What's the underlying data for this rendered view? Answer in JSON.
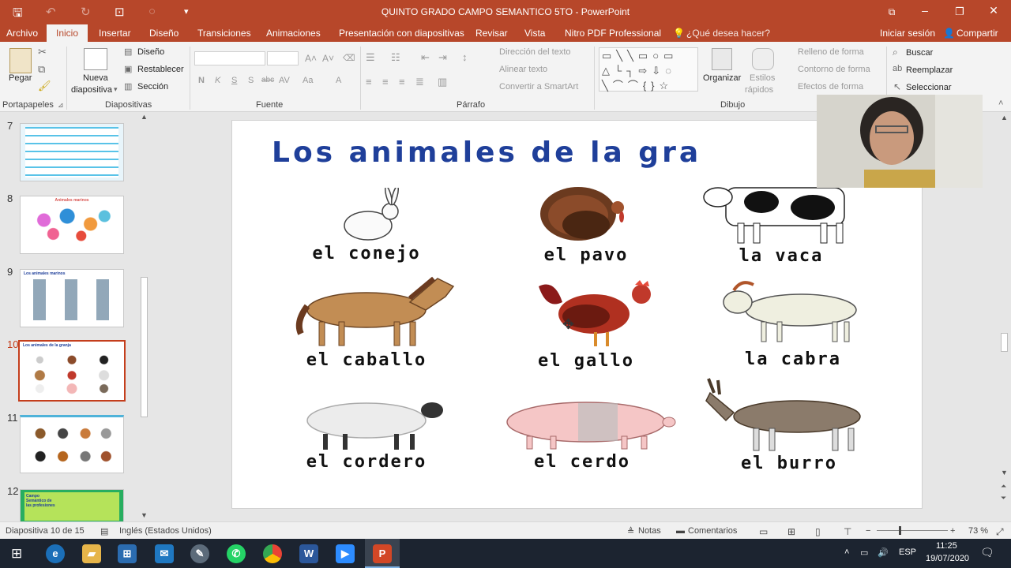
{
  "app": {
    "title": "QUINTO GRADO CAMPO SEMANTICO 5TO - PowerPoint"
  },
  "tabs": [
    "Archivo",
    "Inicio",
    "Insertar",
    "Diseño",
    "Transiciones",
    "Animaciones",
    "Presentación con diapositivas",
    "Revisar",
    "Vista",
    "Nitro PDF Professional"
  ],
  "tellme": "¿Qué desea hacer?",
  "signin": "Iniciar sesión",
  "share": "Compartir",
  "ribbon": {
    "pegar": "Pegar",
    "nueva": "Nueva",
    "diapositiva": "diapositiva",
    "diseno": "Diseño",
    "restablecer": "Restablecer",
    "seccion": "Sección",
    "font_btns": [
      "N",
      "K",
      "S",
      "S",
      "abc",
      "AV",
      "Aa",
      "A"
    ],
    "direccion": "Dirección del texto",
    "alinear": "Alinear texto",
    "convertir": "Convertir a SmartArt",
    "organizar": "Organizar",
    "estilos": "Estilos",
    "rapidos": "rápidos",
    "relleno": "Relleno de forma",
    "contorno": "Contorno de forma",
    "efectos": "Efectos de forma",
    "buscar": "Buscar",
    "reemplazar": "Reemplazar",
    "seleccionar": "Seleccionar",
    "groups": [
      "Portapapeles",
      "Diapositivas",
      "Fuente",
      "Párrafo",
      "Dibujo"
    ]
  },
  "slides": [
    {
      "num": "7",
      "caption": ""
    },
    {
      "num": "8",
      "caption": "Animales marinos"
    },
    {
      "num": "9",
      "caption": "Los animales marinos"
    },
    {
      "num": "10",
      "caption": "Los animales de la granja"
    },
    {
      "num": "11",
      "caption": ""
    },
    {
      "num": "12",
      "caption": "Campo Semántico de las profesiones"
    }
  ],
  "slide": {
    "title": "Los animales de la gra",
    "animals": [
      "el conejo",
      "el pavo",
      "la vaca",
      "el caballo",
      "el gallo",
      "la cabra",
      "el cordero",
      "el cerdo",
      "el burro"
    ]
  },
  "status": {
    "slide": "Diapositiva 10 de 15",
    "lang": "Inglés (Estados Unidos)",
    "notas": "Notas",
    "comentarios": "Comentarios",
    "zoom": "73 %"
  },
  "taskbar": {
    "lang": "ESP",
    "time": "11:25",
    "date": "19/07/2020"
  },
  "colors": {
    "accent": "#b7472a",
    "title_blue": "#1f3f9a"
  }
}
